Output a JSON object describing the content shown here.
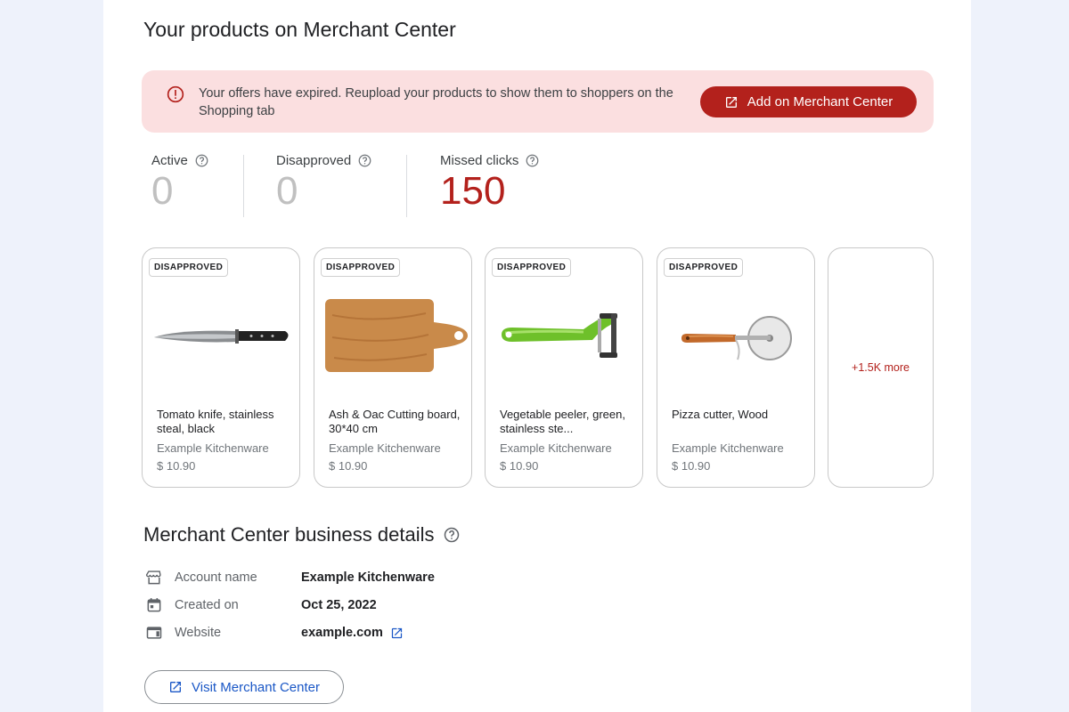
{
  "page": {
    "title": "Your products on Merchant Center"
  },
  "alert": {
    "icon": "error-circle-icon",
    "message": "Your offers have expired. Reupload your products to show them to shoppers on the Shopping tab",
    "button_label": "Add on Merchant Center",
    "button_icon": "open-in-new-icon",
    "background_color": "#fbdfe0",
    "button_color": "#b3211c"
  },
  "stats": [
    {
      "label": "Active",
      "value": "0"
    },
    {
      "label": "Disapproved",
      "value": "0"
    },
    {
      "label": "Missed clicks",
      "value": "150",
      "color": "#b3211c"
    }
  ],
  "products": [
    {
      "badge": "DISAPPROVED",
      "name": "Tomato knife, stainless steal, black",
      "merchant": "Example Kitchenware",
      "price": "$ 10.90",
      "image_icon": "knife-image"
    },
    {
      "badge": "DISAPPROVED",
      "name": "Ash & Oac Cutting board, 30*40 cm",
      "merchant": "Example Kitchenware",
      "price": "$ 10.90",
      "image_icon": "cutting-board-image"
    },
    {
      "badge": "DISAPPROVED",
      "name": "Vegetable peeler, green, stainless ste...",
      "merchant": "Example Kitchenware",
      "price": "$ 10.90",
      "image_icon": "peeler-image"
    },
    {
      "badge": "DISAPPROVED",
      "name": "Pizza cutter, Wood",
      "merchant": "Example Kitchenware",
      "price": "$ 10.90",
      "image_icon": "pizza-cutter-image"
    }
  ],
  "more_products": "+1.5K more",
  "business_details": {
    "title": "Merchant Center business details",
    "rows": [
      {
        "icon": "storefront-icon",
        "label": "Account name",
        "value": "Example Kitchenware"
      },
      {
        "icon": "calendar-icon",
        "label": "Created on",
        "value": "Oct 25, 2022"
      },
      {
        "icon": "web-icon",
        "label": "Website",
        "value": "example.com"
      }
    ]
  },
  "visit_button": {
    "label": "Visit Merchant Center",
    "icon": "open-in-new-icon",
    "color": "#1a57c6"
  }
}
